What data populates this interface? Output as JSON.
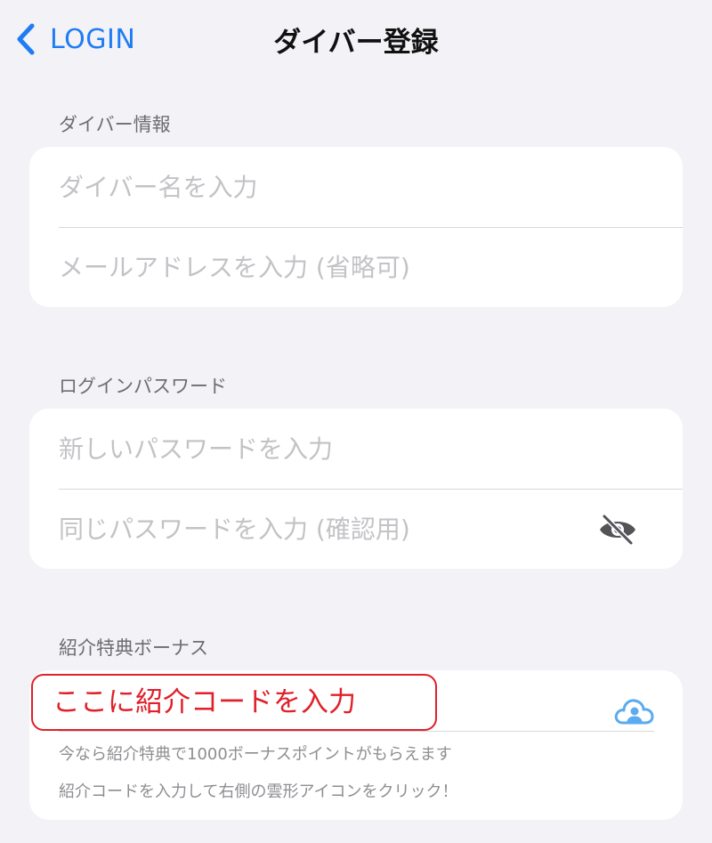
{
  "nav": {
    "back_label": "LOGIN",
    "title": "ダイバー登録"
  },
  "diver_info": {
    "header": "ダイバー情報",
    "name_placeholder": "ダイバー名を入力",
    "email_placeholder": "メールアドレスを入力 (省略可)"
  },
  "password": {
    "header": "ログインパスワード",
    "new_placeholder": "新しいパスワードを入力",
    "confirm_placeholder": "同じパスワードを入力 (確認用)"
  },
  "referral": {
    "header": "紹介特典ボーナス",
    "code_placeholder": "ここに紹介コードを入力",
    "hint1": "今なら紹介特典で1000ボーナスポイントがもらえます",
    "hint2": "紹介コードを入力して右側の雲形アイコンをクリック！"
  },
  "colors": {
    "accent": "#1f7cf3",
    "highlight": "#e0202a",
    "cloud": "#5aabf0",
    "background": "#f2f2f7"
  },
  "icons": [
    "chevron-left-icon",
    "eye-slash-icon",
    "cloud-user-icon"
  ]
}
